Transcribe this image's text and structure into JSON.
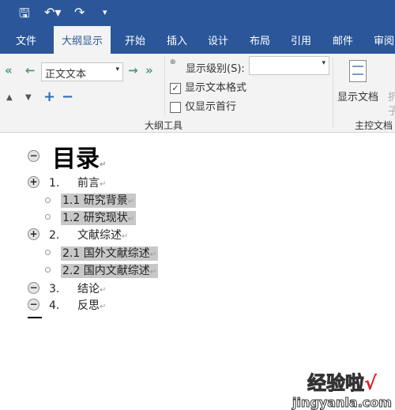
{
  "qat": {
    "save_icon": "save-icon",
    "undo_icon": "undo-icon",
    "redo_icon": "redo-icon",
    "customize_icon": "customize-icon"
  },
  "tabs": [
    "文件",
    "大纲显示",
    "开始",
    "插入",
    "设计",
    "布局",
    "引用",
    "邮件",
    "审阅"
  ],
  "ribbon": {
    "level_select": "正文文本",
    "show_level_label": "显示级别(S):",
    "show_level_value": "",
    "show_text_format": "显示文本格式",
    "show_text_format_checked": true,
    "first_line_only": "仅显示首行",
    "first_line_only_checked": false,
    "group_outline": "大纲工具",
    "show_document": "显示文档",
    "collapse_sub": "折",
    "collapse_sub2": "子",
    "group_master": "主控文档"
  },
  "doc": {
    "title": "目录",
    "items": [
      {
        "num": "1.",
        "text": "前言",
        "symbol": "plus"
      },
      {
        "text": "1.1 研究背景",
        "symbol": "dot"
      },
      {
        "text": "1.2 研究现状",
        "symbol": "dot"
      },
      {
        "num": "2.",
        "text": "文献综述",
        "symbol": "plus"
      },
      {
        "text": "2.1 国外文献综述",
        "symbol": "dot"
      },
      {
        "text": "2.2 国内文献综述",
        "symbol": "dot"
      },
      {
        "num": "3.",
        "text": "结论",
        "symbol": "minus"
      },
      {
        "num": "4.",
        "text": "反思",
        "symbol": "minus"
      }
    ]
  },
  "watermark": {
    "text": "经验啦",
    "url": "jingyanla.com"
  }
}
